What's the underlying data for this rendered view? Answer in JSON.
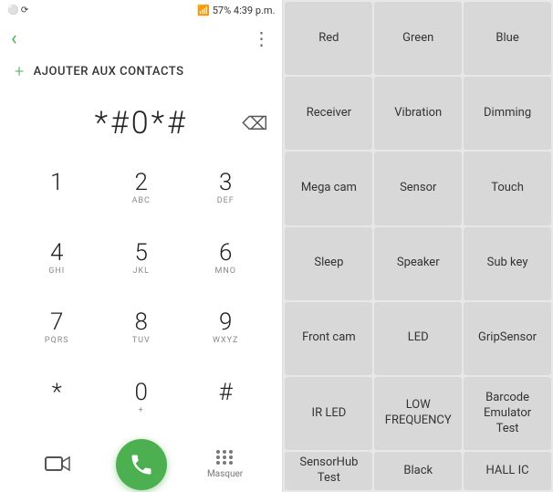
{
  "status": {
    "left_icons": "⚪ ⟳",
    "signal": "📶",
    "battery": "57%",
    "time": "4:39 p.m."
  },
  "dialer": {
    "back_label": "‹",
    "more_label": "⋮",
    "add_contact_label": "AJOUTER AUX CONTACTS",
    "number": "*#0*#",
    "backspace_label": "⌫",
    "keys": [
      {
        "main": "1",
        "sub": ""
      },
      {
        "main": "2",
        "sub": "ABC"
      },
      {
        "main": "3",
        "sub": "DEF"
      },
      {
        "main": "4",
        "sub": "GHI"
      },
      {
        "main": "5",
        "sub": "JKL"
      },
      {
        "main": "6",
        "sub": "MNO"
      },
      {
        "main": "7",
        "sub": "PQRS"
      },
      {
        "main": "8",
        "sub": "TUV"
      },
      {
        "main": "9",
        "sub": "WXYZ"
      },
      {
        "main": "*",
        "sub": ""
      },
      {
        "main": "0",
        "sub": "+"
      },
      {
        "main": "#",
        "sub": ""
      }
    ],
    "masquer_label": "Masquer"
  },
  "test_buttons": [
    "Red",
    "Green",
    "Blue",
    "Receiver",
    "Vibration",
    "Dimming",
    "Mega cam",
    "Sensor",
    "Touch",
    "Sleep",
    "Speaker",
    "Sub key",
    "Front cam",
    "LED",
    "GripSensor",
    "IR LED",
    "LOW\nFREQUENCY",
    "Barcode\nEmulator\nTest",
    "SensorHub\nTest",
    "Black",
    "HALL IC"
  ]
}
